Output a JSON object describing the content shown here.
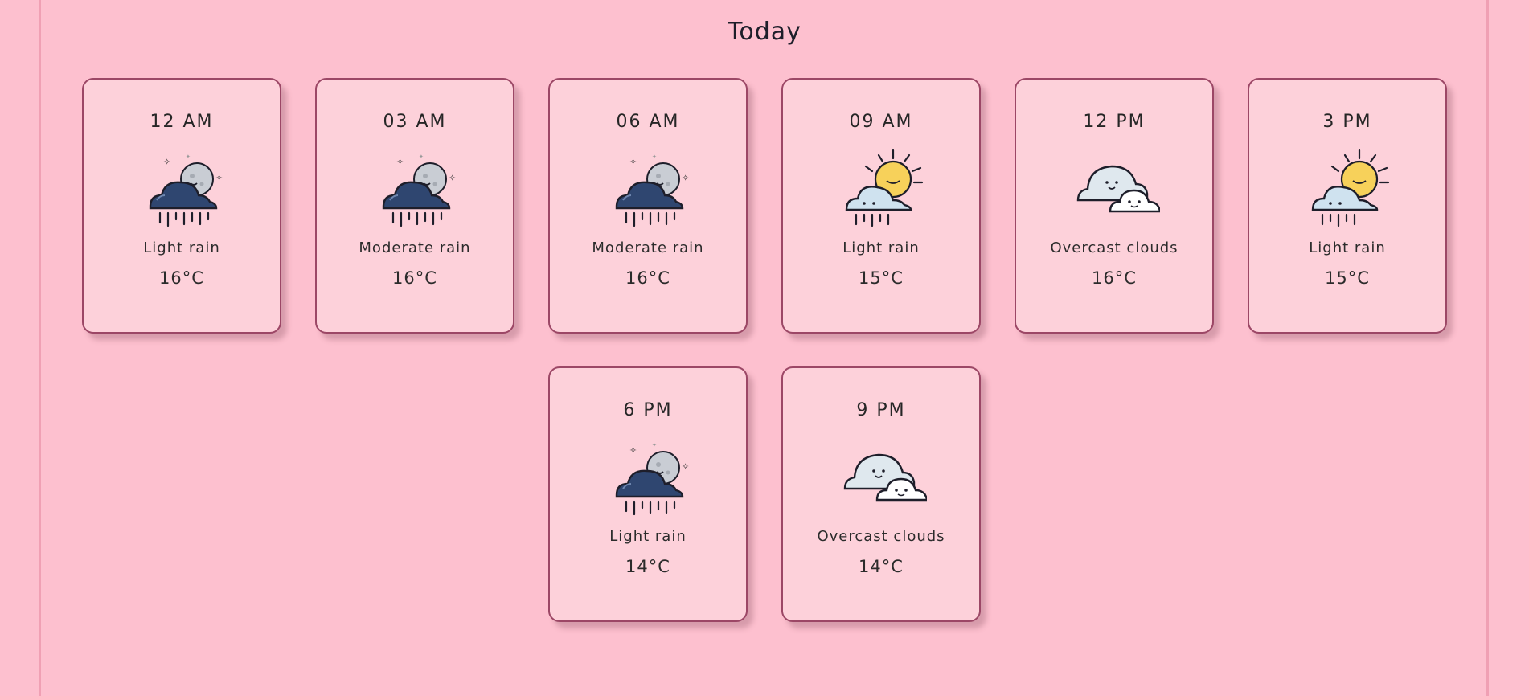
{
  "page": {
    "title": "Today"
  },
  "colors": {
    "background": "#fdc0cf",
    "card": "#fdd1da",
    "card_border": "#9c4766",
    "night_cloud": "#2f4670",
    "day_cloud": "#cfe2ef",
    "sun": "#f7d15a",
    "overcast": "#dfe8ee"
  },
  "forecast": [
    {
      "time": "12 AM",
      "description": "Light rain",
      "temp": "16°C",
      "icon": "night-rain-icon"
    },
    {
      "time": "03 AM",
      "description": "Moderate rain",
      "temp": "16°C",
      "icon": "night-rain-icon"
    },
    {
      "time": "06 AM",
      "description": "Moderate rain",
      "temp": "16°C",
      "icon": "night-rain-icon"
    },
    {
      "time": "09 AM",
      "description": "Light rain",
      "temp": "15°C",
      "icon": "sun-rain-icon"
    },
    {
      "time": "12 PM",
      "description": "Overcast clouds",
      "temp": "16°C",
      "icon": "overcast-clouds-icon"
    },
    {
      "time": "3 PM",
      "description": "Light rain",
      "temp": "15°C",
      "icon": "sun-rain-icon"
    },
    {
      "time": "6 PM",
      "description": "Light rain",
      "temp": "14°C",
      "icon": "night-rain-icon"
    },
    {
      "time": "9 PM",
      "description": "Overcast clouds",
      "temp": "14°C",
      "icon": "overcast-clouds-icon"
    }
  ]
}
